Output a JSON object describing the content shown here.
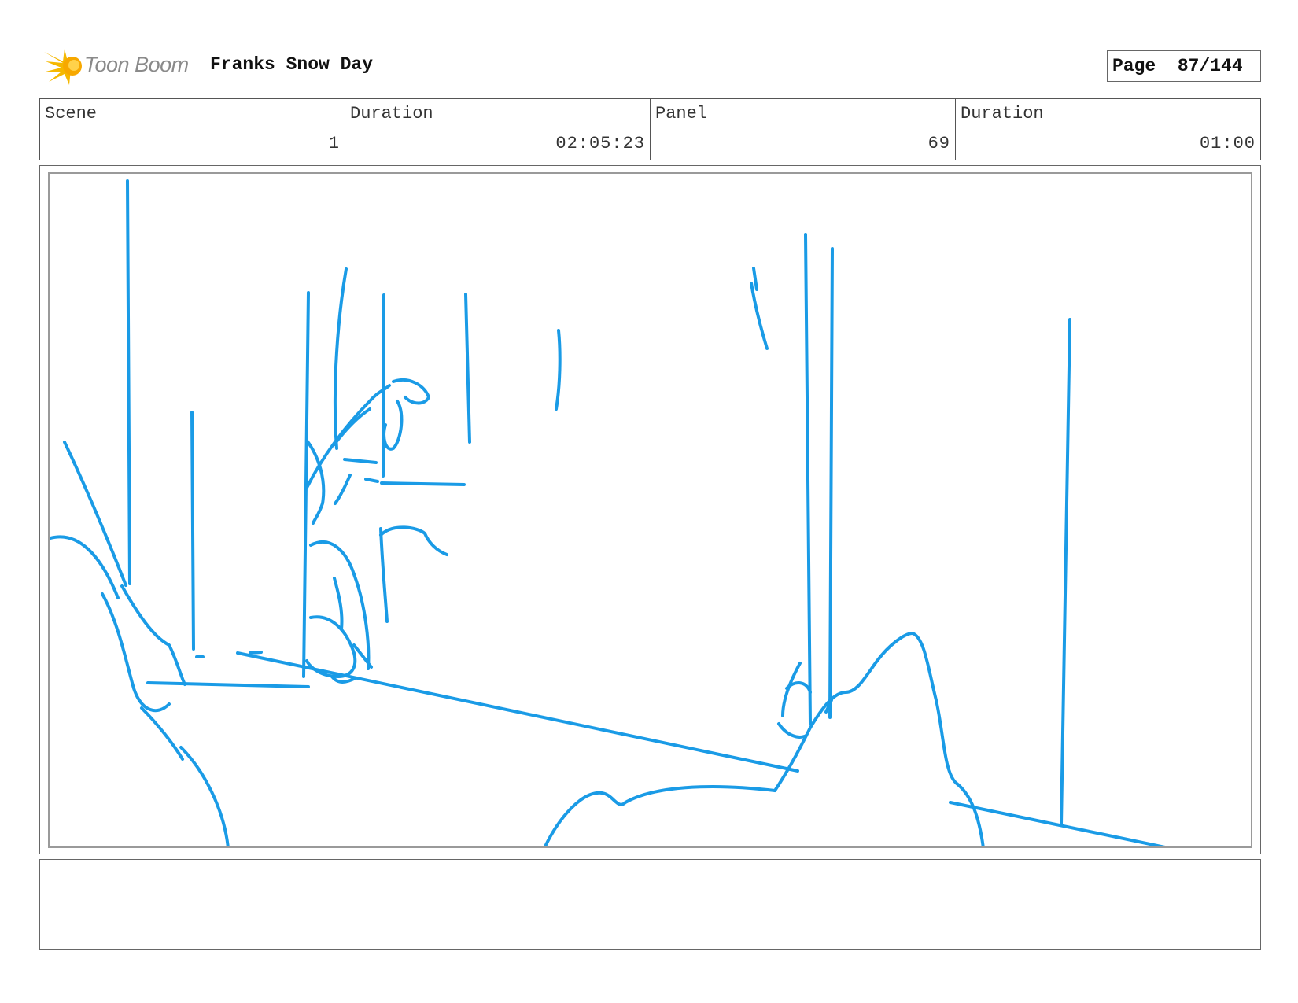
{
  "header": {
    "logo_text": "Toon Boom",
    "project_title": "Franks Snow Day",
    "page_label": "Page",
    "page_value": "87/144"
  },
  "info": {
    "scene_label": "Scene",
    "scene_value": "1",
    "scene_duration_label": "Duration",
    "scene_duration_value": "02:05:23",
    "panel_label": "Panel",
    "panel_value": "69",
    "panel_duration_label": "Duration",
    "panel_duration_value": "01:00"
  },
  "sketch": {
    "stroke_color": "#1a9be6"
  },
  "notes": {
    "text": ""
  }
}
